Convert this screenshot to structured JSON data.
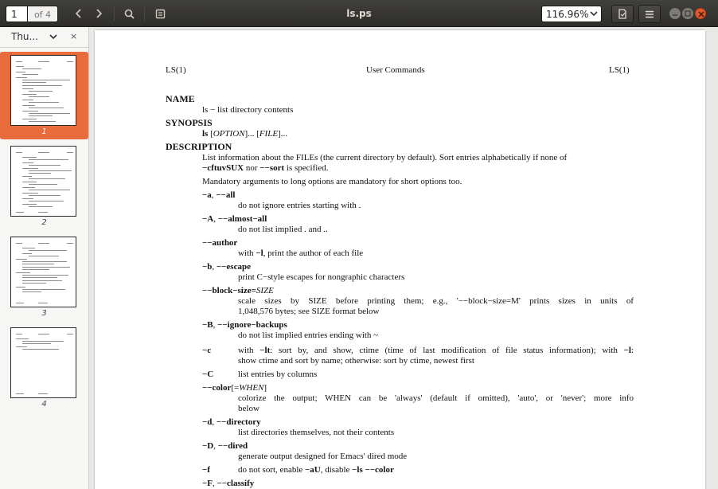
{
  "toolbar": {
    "page_current": "1",
    "page_total": "of 4",
    "title": "ls.ps",
    "zoom": "116.96%"
  },
  "sidebar": {
    "mode_label": "Thu...",
    "close_label": "×",
    "thumbnails": [
      {
        "label": "1",
        "selected": true
      },
      {
        "label": "2",
        "selected": false
      },
      {
        "label": "3",
        "selected": false
      },
      {
        "label": "4",
        "selected": false
      }
    ]
  },
  "document": {
    "header_left": "LS(1)",
    "header_center": "User Commands",
    "header_right": "LS(1)",
    "name_heading": "NAME",
    "name_text": "ls − list directory contents",
    "synopsis_heading": "SYNOPSIS",
    "syn_cmd": "ls",
    "syn_br1": " [",
    "syn_option": "OPTION",
    "syn_br2": "]... [",
    "syn_file": "FILE",
    "syn_br3": "]...",
    "description_heading": "DESCRIPTION",
    "desc1_line1": "List information about the FILEs (the current directory by default).  Sort entries alphabetically if none of",
    "desc1_l2_bold1": "−cftuvSUX",
    "desc1_l2_mid": " nor ",
    "desc1_l2_bold2": "−−sort",
    "desc1_l2_end": " is specified.",
    "desc2": "Mandatory arguments to long options are mandatory for short options too.",
    "opt_a_1": "−a",
    "opt_a_sep": ", ",
    "opt_a_2": "−−all",
    "opt_a_desc": "do not ignore entries starting with .",
    "opt_A_1": "−A",
    "opt_A_sep": ", ",
    "opt_A_2": "−−almost−all",
    "opt_A_desc": "do not list implied . and ..",
    "opt_author": "−−author",
    "opt_author_d1": "with ",
    "opt_author_bl": "−l",
    "opt_author_d2": ", print the author of each file",
    "opt_b_1": "−b",
    "opt_b_sep": ", ",
    "opt_b_2": "−−escape",
    "opt_b_desc": "print C−style escapes for nongraphic characters",
    "opt_bs": "−−block−size=",
    "opt_bs_it": "SIZE",
    "opt_bs_desc1": "scale sizes by SIZE before printing them; e.g., '−−block−size=M' prints sizes in units of",
    "opt_bs_desc2": "1,048,576 bytes; see SIZE format below",
    "opt_B_1": "−B",
    "opt_B_sep": ", ",
    "opt_B_2": "−−ignore−backups",
    "opt_B_desc": "do not list implied entries ending with ~",
    "opt_c": "−c",
    "opt_c_d1a": "with ",
    "opt_c_bl1": "−lt",
    "opt_c_d1b": ": sort by, and show, ctime (time of last modification of file status information); with ",
    "opt_c_bl2": "−l",
    "opt_c_d1c": ":",
    "opt_c_d2": "show ctime and sort by name; otherwise: sort by ctime, newest first",
    "opt_C": "−C",
    "opt_C_desc": "list entries by columns",
    "opt_color": "−−color",
    "opt_color_br1": "[=",
    "opt_color_it": "WHEN",
    "opt_color_br2": "]",
    "opt_color_desc1": "colorize the output; WHEN can be 'always' (default if omitted), 'auto', or 'never'; more info",
    "opt_color_desc2": "below",
    "opt_d_1": "−d",
    "opt_d_sep": ", ",
    "opt_d_2": "−−directory",
    "opt_d_desc": "list directories themselves, not their contents",
    "opt_D_1": "−D",
    "opt_D_sep": ", ",
    "opt_D_2": "−−dired",
    "opt_D_desc": "generate output designed for Emacs' dired mode",
    "opt_f": "−f",
    "opt_f_d1": "do not sort, enable ",
    "opt_f_bl1": "−aU",
    "opt_f_d2": ", disable ",
    "opt_f_bl2": "−ls −−color",
    "opt_F_1": "−F",
    "opt_F_sep": ", ",
    "opt_F_2": "−−classify"
  }
}
